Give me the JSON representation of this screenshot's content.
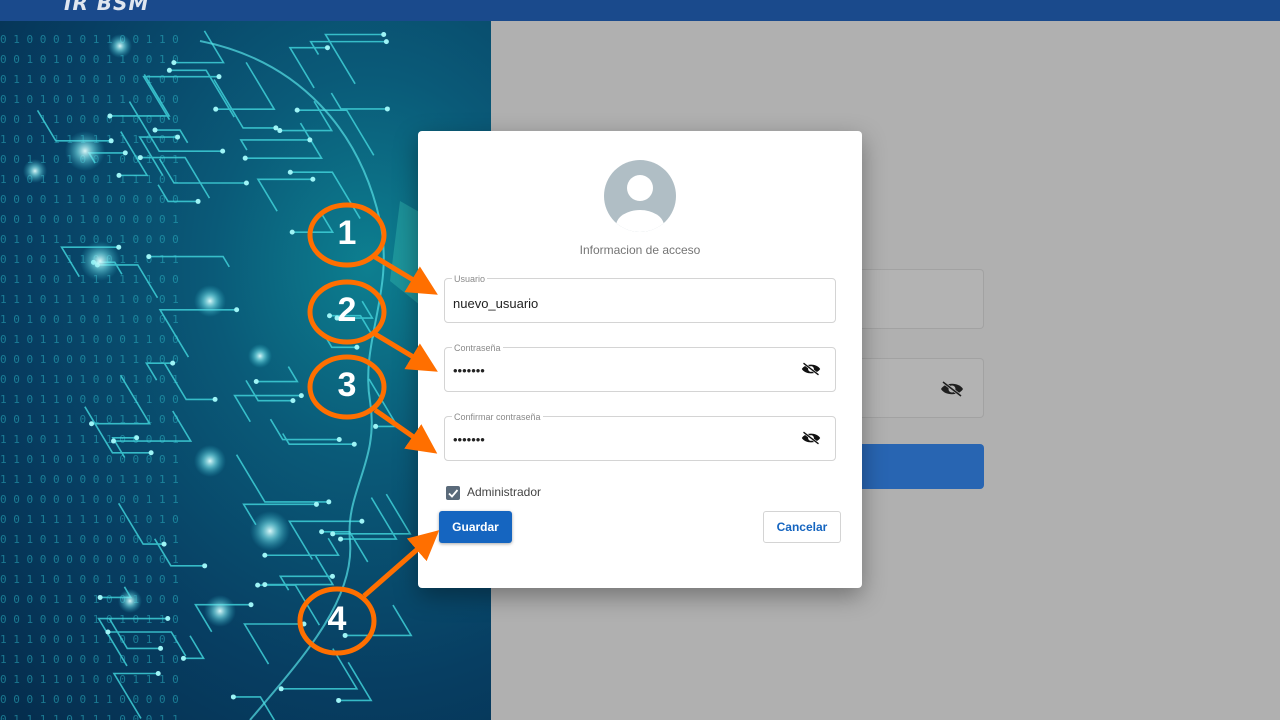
{
  "brand": {
    "name": "IR BSM"
  },
  "dialog": {
    "title": "Informacion de acceso",
    "fields": {
      "user": {
        "label": "Usuario",
        "value": "nuevo_usuario"
      },
      "password": {
        "label": "Contraseña",
        "value": "•••••••"
      },
      "confirm": {
        "label": "Confirmar contraseña",
        "value": "•••••••"
      }
    },
    "admin_checkbox": {
      "label": "Administrador",
      "checked": true
    },
    "save_label": "Guardar",
    "cancel_label": "Cancelar"
  },
  "annotations": [
    "1",
    "2",
    "3",
    "4"
  ],
  "colors": {
    "topbar": "#1a4a8c",
    "primary": "#1565c0",
    "annotation": "#ff6f00"
  },
  "icons": {
    "avatar": "account-circle-icon",
    "visibility": "eye-off-icon",
    "check": "checkbox-checked-icon"
  }
}
